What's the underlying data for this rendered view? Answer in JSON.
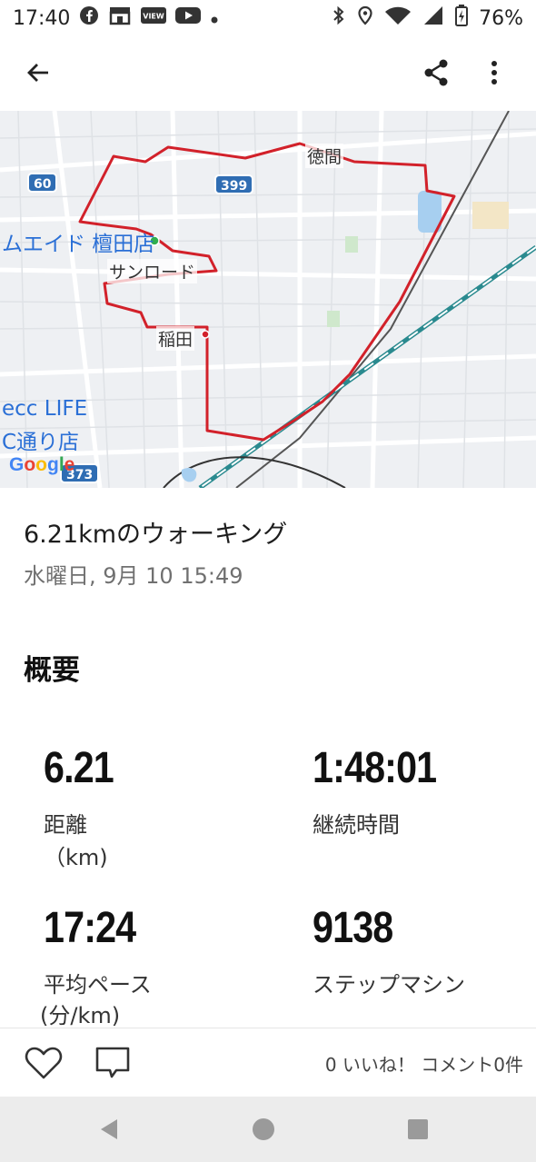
{
  "status": {
    "time": "17:40",
    "battery": "76%",
    "view_label": "VIEW"
  },
  "map": {
    "labels": {
      "tokuma": "徳間",
      "sunroad": "サンロード",
      "inada": "稲田",
      "store_top": "ムエイド 檀田店",
      "store_bottom_1": "ecc LIFE",
      "store_bottom_2": "C通り店"
    },
    "roads": {
      "r60": "60",
      "r399": "399",
      "r373": "373"
    },
    "logo": "Google",
    "route_color": "#d2212a"
  },
  "activity": {
    "title": "6.21kmのウォーキング",
    "date": "水曜日, 9月 10 15:49"
  },
  "summary": {
    "heading": "概要",
    "distance": {
      "value": "6.21",
      "label": "距離",
      "unit": "（km)"
    },
    "duration": {
      "value": "1:48:01",
      "label": "継続時間"
    },
    "pace": {
      "value": "17:24",
      "label": "平均ペース",
      "unit": "(分/km)"
    },
    "steps": {
      "value": "9138",
      "label": "ステップマシン"
    }
  },
  "actions": {
    "likes_comments": "0 いいね！ コメント0件"
  },
  "icons": [
    "back-arrow-icon",
    "share-icon",
    "more-vert-icon",
    "heart-icon",
    "comment-icon",
    "nav-back-icon",
    "nav-home-icon",
    "nav-recents-icon"
  ]
}
